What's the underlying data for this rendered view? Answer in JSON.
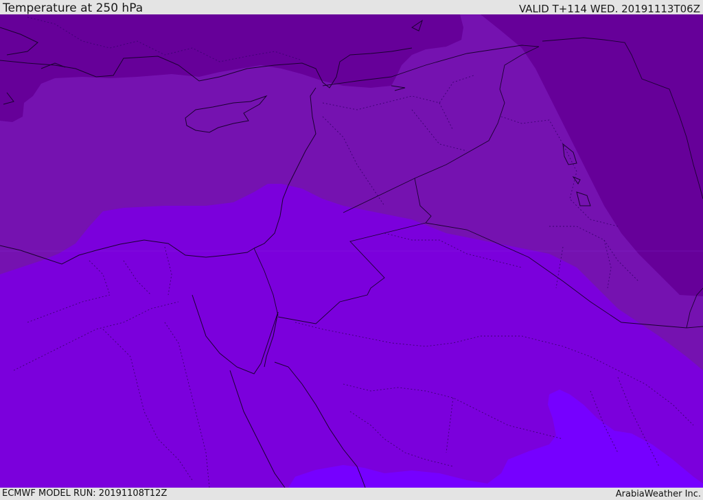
{
  "header": {
    "title": "Temperature at 250 hPa",
    "valid_time": "VALID T+114 WED. 20191113T06Z"
  },
  "footer": {
    "model_run": "ECMWF MODEL RUN: 20191108T12Z",
    "credit": "ArabiaWeather Inc."
  },
  "map": {
    "variable": "Temperature",
    "level": "250 hPa",
    "colors": {
      "darkest_band": "#660099",
      "dark_band": "#7512b0",
      "mid_band": "#7b00dc",
      "light_band": "#7600ff",
      "coastline": "#1a0030",
      "border_dotted": "#3b0070"
    }
  }
}
